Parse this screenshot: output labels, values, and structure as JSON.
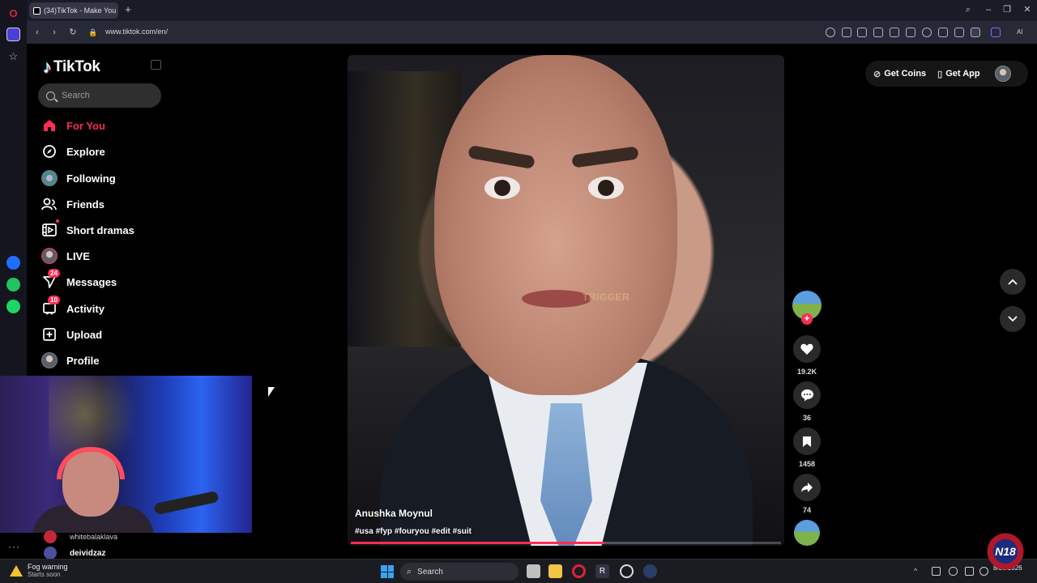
{
  "browser": {
    "tab_title": "(34)TikTok - Make You",
    "url": "www.tiktok.com/en/"
  },
  "tiktok": {
    "logo_text": "TikTok",
    "search_placeholder": "Search",
    "nav": [
      {
        "label": "For You",
        "icon": "home-icon",
        "active": true
      },
      {
        "label": "Explore",
        "icon": "compass-icon"
      },
      {
        "label": "Following",
        "icon": "following-avatar-icon"
      },
      {
        "label": "Friends",
        "icon": "friends-icon"
      },
      {
        "label": "Short dramas",
        "icon": "film-icon"
      },
      {
        "label": "LIVE",
        "icon": "live-avatar-icon"
      },
      {
        "label": "Messages",
        "icon": "message-send-icon",
        "badge": "24"
      },
      {
        "label": "Activity",
        "icon": "inbox-icon",
        "badge": "10"
      },
      {
        "label": "Upload",
        "icon": "plus-square-icon"
      },
      {
        "label": "Profile",
        "icon": "profile-avatar-icon"
      }
    ],
    "top_right": {
      "get_coins": "Get Coins",
      "get_app": "Get App"
    },
    "video": {
      "author": "Anushka Moynul",
      "hashtags": "#usa #fyp #fouryou #edit #suit",
      "overlay_text": "TRIGGER",
      "progress": 0.59
    },
    "actions": {
      "likes": "19.2K",
      "comments": "36",
      "saves": "1458",
      "shares": "74"
    }
  },
  "stream_overlay": {
    "chat": [
      {
        "user": "whitebalaklava"
      },
      {
        "user": "deividzaz"
      }
    ]
  },
  "taskbar": {
    "weather_title": "Fog warning",
    "weather_sub": "Starts soon",
    "search_label": "Search",
    "date": "8/30/2026"
  },
  "colors": {
    "accent": "#fe2c55",
    "page_bg": "#000000",
    "browser_bg": "#1a1b27"
  }
}
